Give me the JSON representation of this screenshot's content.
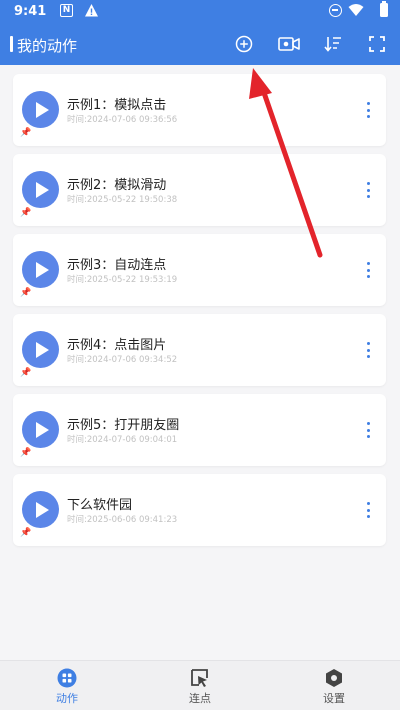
{
  "status": {
    "time": "9:41",
    "notification_letter": "N"
  },
  "header": {
    "title": "我的动作",
    "icons": [
      "add-circle-icon",
      "record-video-icon",
      "sort-icon",
      "fullscreen-icon"
    ]
  },
  "actions": [
    {
      "title": "示例1：模拟点击",
      "time": "时间:2024-07-06 09:36:56"
    },
    {
      "title": "示例2：模拟滑动",
      "time": "时间:2025-05-22 19:50:38"
    },
    {
      "title": "示例3：自动连点",
      "time": "时间:2025-05-22 19:53:19"
    },
    {
      "title": "示例4：点击图片",
      "time": "时间:2024-07-06 09:34:52"
    },
    {
      "title": "示例5：打开朋友圈",
      "time": "时间:2024-07-06 09:04:01"
    },
    {
      "title": "下么软件园",
      "time": "时间:2025-06-06 09:41:23"
    }
  ],
  "tabs": [
    {
      "label": "动作",
      "icon": "actions-grid-icon",
      "active": true
    },
    {
      "label": "连点",
      "icon": "cursor-click-icon",
      "active": false
    },
    {
      "label": "设置",
      "icon": "settings-hex-icon",
      "active": false
    }
  ],
  "colors": {
    "primary": "#3f7fe3",
    "play": "#5b86e8",
    "annotation_arrow": "#e3242b"
  }
}
